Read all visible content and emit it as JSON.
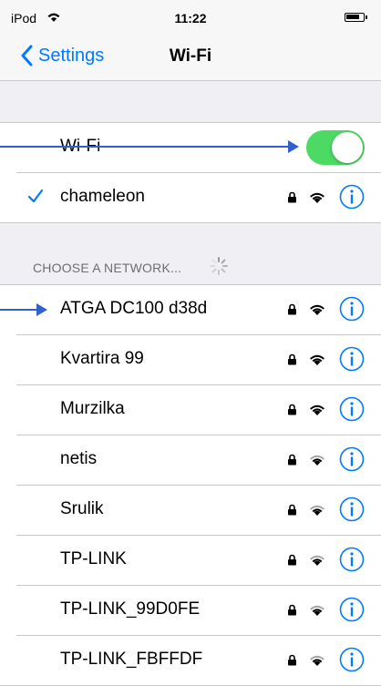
{
  "status_bar": {
    "carrier": "iPod",
    "time": "11:22"
  },
  "nav": {
    "back_label": "Settings",
    "title": "Wi-Fi"
  },
  "wifi_toggle": {
    "label": "Wi-Fi",
    "enabled": true,
    "accent_color": "#4cd964"
  },
  "connected_network": {
    "name": "chameleon",
    "icons": [
      "checkmark-icon",
      "lock-icon",
      "wifi-icon",
      "info-icon"
    ]
  },
  "section_header": "CHOOSE A NETWORK...",
  "networks": [
    {
      "name": "ATGA DC100 d38d"
    },
    {
      "name": "Kvartira 99"
    },
    {
      "name": "Murzilka"
    },
    {
      "name": "netis"
    },
    {
      "name": "Srulik"
    },
    {
      "name": "TP-LINK"
    },
    {
      "name": "TP-LINK_99D0FE"
    },
    {
      "name": "TP-LINK_FBFFDF"
    }
  ],
  "colors": {
    "ios_blue": "#007aff",
    "annotation_arrow": "#2f5fd1",
    "background": "#efeff4"
  }
}
